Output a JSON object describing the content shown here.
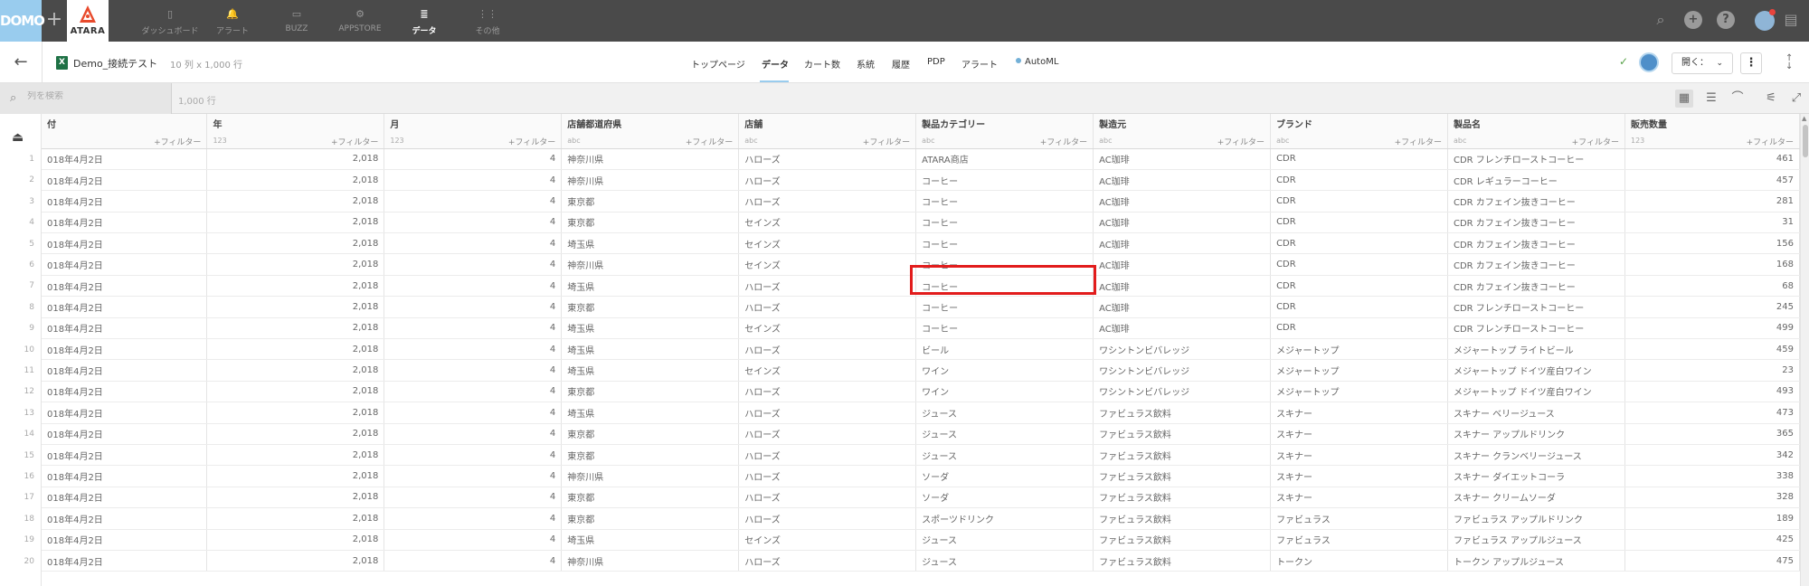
{
  "topnav": {
    "logo": "DOMO",
    "brand_name": "ATARA",
    "items": [
      {
        "label": "ダッシュボード",
        "icon": "▯"
      },
      {
        "label": "アラート",
        "icon": "🔔"
      },
      {
        "label": "BUZZ",
        "icon": "▭"
      },
      {
        "label": "APPSTORE",
        "icon": "⚙"
      },
      {
        "label": "データ",
        "icon": "≣"
      },
      {
        "label": "その他",
        "icon": "⋮⋮"
      }
    ],
    "active_item": "データ"
  },
  "header": {
    "dataset_name": "Demo_接続テスト",
    "dataset_meta": "10 列 x 1,000 行",
    "tabs": [
      "トップページ",
      "データ",
      "カート数",
      "系統",
      "履歴",
      "PDP",
      "アラート",
      "AutoML"
    ],
    "active_tab": "データ",
    "open_button": "開く：",
    "accent_color": "#99ccee"
  },
  "toolbar": {
    "search_placeholder": "列を検索",
    "row_count": "1,000 行"
  },
  "table": {
    "filter_label": "+フィルター",
    "columns": [
      {
        "name": "付",
        "type": ""
      },
      {
        "name": "年",
        "type": "123"
      },
      {
        "name": "月",
        "type": "123"
      },
      {
        "name": "店舗都道府県",
        "type": "abc"
      },
      {
        "name": "店舗",
        "type": "abc"
      },
      {
        "name": "製品カテゴリー",
        "type": "abc"
      },
      {
        "name": "製造元",
        "type": "abc"
      },
      {
        "name": "ブランド",
        "type": "abc"
      },
      {
        "name": "製品名",
        "type": "abc"
      },
      {
        "name": "販売数量",
        "type": "123"
      }
    ],
    "rows": [
      [
        "1",
        "018年4月2日",
        "2,018",
        "4",
        "神奈川県",
        "ハローズ",
        "ATARA商店",
        "AC珈琲",
        "CDR",
        "CDR フレンチローストコーヒー",
        "461"
      ],
      [
        "2",
        "018年4月2日",
        "2,018",
        "4",
        "神奈川県",
        "ハローズ",
        "コーヒー",
        "AC珈琲",
        "CDR",
        "CDR レギュラーコーヒー",
        "457"
      ],
      [
        "3",
        "018年4月2日",
        "2,018",
        "4",
        "東京都",
        "ハローズ",
        "コーヒー",
        "AC珈琲",
        "CDR",
        "CDR カフェイン抜きコーヒー",
        "281"
      ],
      [
        "4",
        "018年4月2日",
        "2,018",
        "4",
        "東京都",
        "セインズ",
        "コーヒー",
        "AC珈琲",
        "CDR",
        "CDR カフェイン抜きコーヒー",
        "31"
      ],
      [
        "5",
        "018年4月2日",
        "2,018",
        "4",
        "埼玉県",
        "セインズ",
        "コーヒー",
        "AC珈琲",
        "CDR",
        "CDR カフェイン抜きコーヒー",
        "156"
      ],
      [
        "6",
        "018年4月2日",
        "2,018",
        "4",
        "神奈川県",
        "セインズ",
        "コーヒー",
        "AC珈琲",
        "CDR",
        "CDR カフェイン抜きコーヒー",
        "168"
      ],
      [
        "7",
        "018年4月2日",
        "2,018",
        "4",
        "埼玉県",
        "ハローズ",
        "コーヒー",
        "AC珈琲",
        "CDR",
        "CDR カフェイン抜きコーヒー",
        "68"
      ],
      [
        "8",
        "018年4月2日",
        "2,018",
        "4",
        "東京都",
        "ハローズ",
        "コーヒー",
        "AC珈琲",
        "CDR",
        "CDR フレンチローストコーヒー",
        "245"
      ],
      [
        "9",
        "018年4月2日",
        "2,018",
        "4",
        "埼玉県",
        "セインズ",
        "コーヒー",
        "AC珈琲",
        "CDR",
        "CDR フレンチローストコーヒー",
        "499"
      ],
      [
        "10",
        "018年4月2日",
        "2,018",
        "4",
        "埼玉県",
        "ハローズ",
        "ビール",
        "ワシントンビバレッジ",
        "メジャートップ",
        "メジャートップ ライトビール",
        "459"
      ],
      [
        "11",
        "018年4月2日",
        "2,018",
        "4",
        "埼玉県",
        "セインズ",
        "ワイン",
        "ワシントンビバレッジ",
        "メジャートップ",
        "メジャートップ ドイツ産白ワイン",
        "23"
      ],
      [
        "12",
        "018年4月2日",
        "2,018",
        "4",
        "東京都",
        "ハローズ",
        "ワイン",
        "ワシントンビバレッジ",
        "メジャートップ",
        "メジャートップ ドイツ産白ワイン",
        "493"
      ],
      [
        "13",
        "018年4月2日",
        "2,018",
        "4",
        "埼玉県",
        "ハローズ",
        "ジュース",
        "ファビュラス飲料",
        "スキナー",
        "スキナー ベリージュース",
        "473"
      ],
      [
        "14",
        "018年4月2日",
        "2,018",
        "4",
        "東京都",
        "ハローズ",
        "ジュース",
        "ファビュラス飲料",
        "スキナー",
        "スキナー アップルドリンク",
        "365"
      ],
      [
        "15",
        "018年4月2日",
        "2,018",
        "4",
        "東京都",
        "ハローズ",
        "ジュース",
        "ファビュラス飲料",
        "スキナー",
        "スキナー クランベリージュース",
        "342"
      ],
      [
        "16",
        "018年4月2日",
        "2,018",
        "4",
        "神奈川県",
        "ハローズ",
        "ソーダ",
        "ファビュラス飲料",
        "スキナー",
        "スキナー ダイエットコーラ",
        "338"
      ],
      [
        "17",
        "018年4月2日",
        "2,018",
        "4",
        "東京都",
        "ハローズ",
        "ソーダ",
        "ファビュラス飲料",
        "スキナー",
        "スキナー クリームソーダ",
        "328"
      ],
      [
        "18",
        "018年4月2日",
        "2,018",
        "4",
        "東京都",
        "ハローズ",
        "スポーツドリンク",
        "ファビュラス飲料",
        "ファビュラス",
        "ファビュラス アップルドリンク",
        "189"
      ],
      [
        "19",
        "018年4月2日",
        "2,018",
        "4",
        "埼玉県",
        "セインズ",
        "ジュース",
        "ファビュラス飲料",
        "ファビュラス",
        "ファビュラス アップルジュース",
        "425"
      ],
      [
        "20",
        "018年4月2日",
        "2,018",
        "4",
        "神奈川県",
        "ハローズ",
        "ジュース",
        "ファビュラス飲料",
        "トークン",
        "トークン アップルジュース",
        "475"
      ]
    ]
  }
}
